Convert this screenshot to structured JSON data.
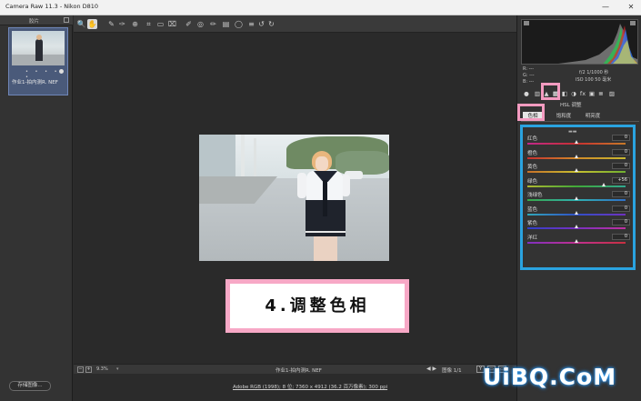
{
  "window": {
    "title": "Camera Raw 11.3 - Nikon D810"
  },
  "filmstrip": {
    "header_label": "胶片",
    "thumbnail": {
      "stars": "• • • • •",
      "filename": "作业1-拍内测R. NEF"
    },
    "save_button": "存储图像..."
  },
  "toolbar": {
    "tools": [
      {
        "icon": "zoom-icon",
        "glyph": "🔍"
      },
      {
        "icon": "hand-icon",
        "glyph": "✋"
      },
      {
        "icon": "white-balance-icon",
        "glyph": "✎"
      },
      {
        "icon": "color-sampler-icon",
        "glyph": "✑"
      },
      {
        "icon": "target-adjust-icon",
        "glyph": "⊕"
      },
      {
        "icon": "crop-icon",
        "glyph": "⌗"
      },
      {
        "icon": "straighten-icon",
        "glyph": "▭"
      },
      {
        "icon": "transform-icon",
        "glyph": "⌧"
      },
      {
        "icon": "spot-removal-icon",
        "glyph": "✐"
      },
      {
        "icon": "red-eye-icon",
        "glyph": "◎"
      },
      {
        "icon": "adjustment-brush-icon",
        "glyph": "✏"
      },
      {
        "icon": "graduated-filter-icon",
        "glyph": "▤"
      },
      {
        "icon": "radial-filter-icon",
        "glyph": "◯"
      },
      {
        "icon": "preferences-icon",
        "glyph": "≡"
      },
      {
        "icon": "rotate-left-icon",
        "glyph": "↺"
      },
      {
        "icon": "rotate-right-icon",
        "glyph": "↻"
      }
    ]
  },
  "canvas": {
    "overlay_label": "4.调整色相"
  },
  "statusbar": {
    "zoom": "9.3%",
    "zoom_dropdown": "▾",
    "filename": "作业1-拍内测R. NEF",
    "nav_arrows": "◀ ▶",
    "image_count": "图像 1/1",
    "btn_y": "Y",
    "footer_info": "Adobe RGB (1998); 8 位; 7360 x 4912 (36.2 百万像素); 300 ppi"
  },
  "histogram": {
    "readout": {
      "r": "R: ---",
      "g": "G: ---",
      "b": "B: ---",
      "camera": "f/2  1/1000 秒",
      "iso": "ISO 100   50 毫米"
    }
  },
  "panel": {
    "title": "HSL 调整",
    "icons": [
      {
        "icon": "basic-icon",
        "glyph": "●"
      },
      {
        "icon": "tone-curve-icon",
        "glyph": "▥"
      },
      {
        "icon": "detail-icon",
        "glyph": "▲"
      },
      {
        "icon": "hsl-icon",
        "glyph": "▦"
      },
      {
        "icon": "split-toning-icon",
        "glyph": "◧"
      },
      {
        "icon": "lens-icon",
        "glyph": "◑"
      },
      {
        "icon": "effects-icon",
        "glyph": "fx"
      },
      {
        "icon": "calibration-icon",
        "glyph": "▣"
      },
      {
        "icon": "presets-icon",
        "glyph": "≣"
      },
      {
        "icon": "snapshots-icon",
        "glyph": "▨"
      }
    ],
    "subtabs": [
      "色相",
      "饱和度",
      "明亮度"
    ],
    "sliders": [
      {
        "name": "红色",
        "value": "0",
        "pos": 0.5,
        "gradient": "linear-gradient(90deg,#c0288a,#c83030,#c87a28)"
      },
      {
        "name": "橙色",
        "value": "0",
        "pos": 0.5,
        "gradient": "linear-gradient(90deg,#c83030,#d08a28,#c8b830)"
      },
      {
        "name": "黄色",
        "value": "0",
        "pos": 0.5,
        "gradient": "linear-gradient(90deg,#c87028,#c8c030,#70b030)"
      },
      {
        "name": "绿色",
        "value": "+56",
        "pos": 0.78,
        "gradient": "linear-gradient(90deg,#b0b830,#40a838,#30a890)"
      },
      {
        "name": "浅绿色",
        "value": "0",
        "pos": 0.5,
        "gradient": "linear-gradient(90deg,#38a848,#30b0b0,#3070c8)"
      },
      {
        "name": "蓝色",
        "value": "0",
        "pos": 0.5,
        "gradient": "linear-gradient(90deg,#30a8b8,#3050c8,#7030c0)"
      },
      {
        "name": "紫色",
        "value": "0",
        "pos": 0.5,
        "gradient": "linear-gradient(90deg,#3040c8,#7830c0,#c030a0)"
      },
      {
        "name": "洋红",
        "value": "0",
        "pos": 0.5,
        "gradient": "linear-gradient(90deg,#8030c0,#c03090,#c83040)"
      }
    ]
  },
  "watermark": {
    "text": "UiBQ.CoM"
  },
  "colors": {
    "highlight_pink": "#f39bc0",
    "highlight_blue": "#2aa3e0",
    "label_border": "#f7a8c6"
  }
}
